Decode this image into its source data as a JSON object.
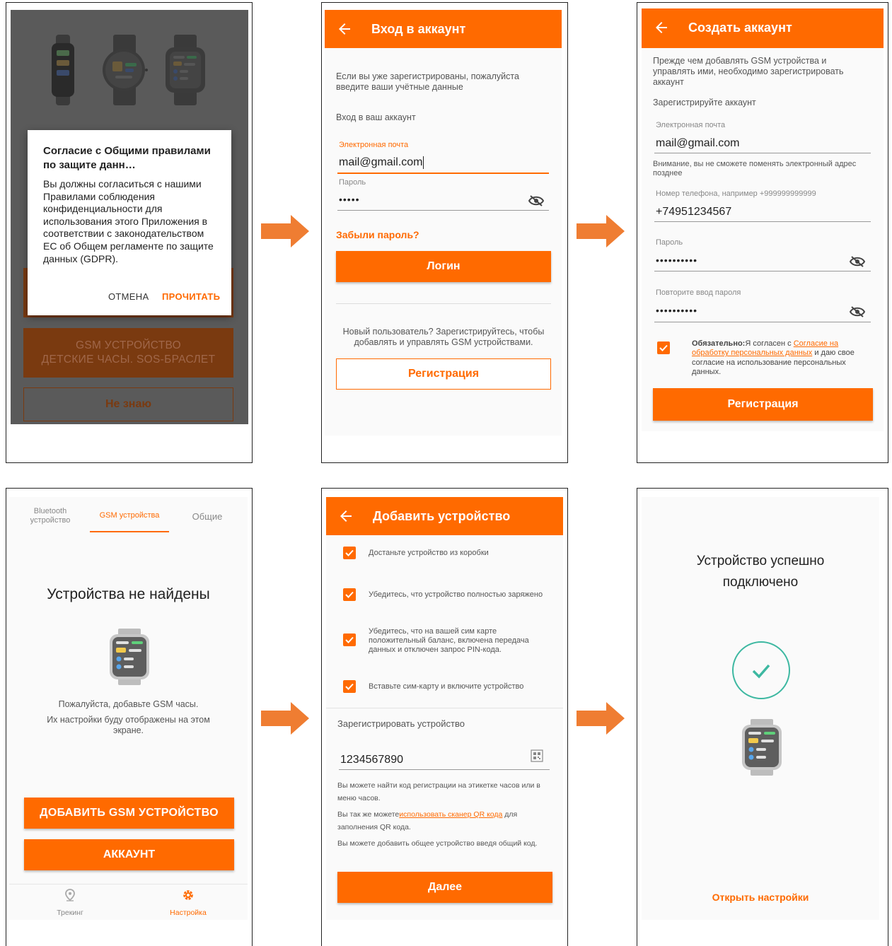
{
  "screen1": {
    "dialog_title": "Согласие с Общими правилами по защите данн…",
    "dialog_body": "Вы должны согласиться с нашими Правилами соблюдения конфиденциальности для использования этого Приложения в соответствии с законодательством ЕС об Общем регламенте по защите данных (GDPR).",
    "cancel_label": "ОТМЕНА",
    "read_label": "ПРОЧИТАТЬ",
    "gsm_button_line1": "GSM УСТРОЙСТВО",
    "gsm_button_line2": "ДЕТСКИЕ ЧАСЫ. SOS-БРАСЛЕТ",
    "dont_know_label": "Не знаю"
  },
  "screen2": {
    "title": "Вход в аккаунт",
    "intro": "Если вы уже зарегистрированы, пожалуйста введите ваши учётные данные",
    "section": "Вход в ваш аккаунт",
    "email_label": "Электронная почта",
    "email_value": "mail@gmail.com",
    "password_label": "Пароль",
    "password_value": "•••••",
    "forgot_label": "Забыли пароль?",
    "login_label": "Логин",
    "new_user_text": "Новый пользователь? Зарегистрируйтесь, чтобы добавлять и управлять GSM устройствами.",
    "register_label": "Регистрация"
  },
  "screen3": {
    "title": "Создать аккаунт",
    "intro": "Прежде чем добавлять GSM устройства и управлять ими, необходимо зарегистрировать аккаунт",
    "section": "Зарегистрируйте аккаунт",
    "email_label": "Электронная почта",
    "email_value": "mail@gmail.com",
    "email_note": "Внимание, вы не сможете поменять электронный адрес позднее",
    "phone_label": "Номер телефона, например +999999999999",
    "phone_value": "+74951234567",
    "password_label": "Пароль",
    "password_value": "••••••••••",
    "repeat_label": "Повторите ввод пароля",
    "repeat_value": "••••••••••",
    "consent_bold": "Обязательно:",
    "consent_pre": "Я согласен с ",
    "consent_link": "Согласие на обработку персональных данных",
    "consent_post": " и даю свое согласие на использование персональных данных.",
    "register_label": "Регистрация"
  },
  "screen4": {
    "tabs": [
      {
        "label": "Bluetooth устройство"
      },
      {
        "label": "GSM устройства"
      },
      {
        "label": "Общие"
      }
    ],
    "empty_title": "Устройства не найдены",
    "hint1": "Пожалуйста, добавьте GSM часы.",
    "hint2": "Их настройки буду отображены на этом экране.",
    "add_label": "ДОБАВИТЬ GSM УСТРОЙСТВО",
    "account_label": "АККАУНТ",
    "nav": [
      {
        "label": "Трекинг",
        "icon": "map-pin-icon"
      },
      {
        "label": "Настройка",
        "icon": "gear-icon"
      }
    ]
  },
  "screen5": {
    "title": "Добавить устройство",
    "steps": [
      {
        "text": "Достаньте устройство из коробки"
      },
      {
        "text": "Убедитесь, что устройство полностью заряжено"
      },
      {
        "text": "Убедитесь, что на вашей сим карте положительный баланс, включена передача данных и отключен запрос PIN-кода."
      },
      {
        "text": "Вставьте сим-карту и включите устройство"
      }
    ],
    "register_section": "Зарегистрировать устройство",
    "code_value": "1234567890",
    "info1": "Вы можете найти код регистрации на этикетке часов или в меню часов.",
    "info2_pre": "Вы так же можете",
    "info2_link": "использовать сканер QR кода",
    "info2_post": " для заполнения QR кода.",
    "info3": "Вы можете добавить общее устройство введя общий код.",
    "next_label": "Далее"
  },
  "screen6": {
    "success_line1": "Устройство успешно",
    "success_line2": "подключено",
    "open_settings_label": "Открыть настройки"
  },
  "colors": {
    "accent": "#ff6a00",
    "arrow": "#ef7d32",
    "success": "#3db8a1"
  }
}
